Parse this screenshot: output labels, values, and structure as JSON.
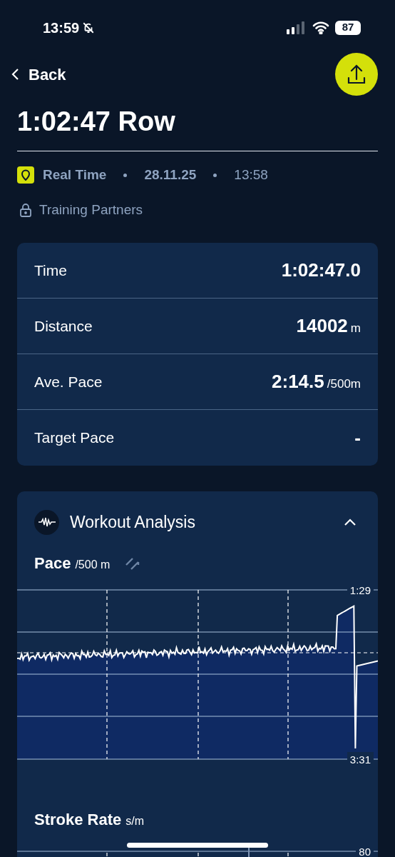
{
  "status_bar": {
    "time": "13:59",
    "battery": "87"
  },
  "nav": {
    "back": "Back"
  },
  "title": "1:02:47 Row",
  "meta": {
    "source": "Real Time",
    "date": "28.11.25",
    "time": "13:58"
  },
  "privacy": "Training Partners",
  "stats": [
    {
      "label": "Time",
      "value": "1:02:47.0"
    },
    {
      "label": "Distance",
      "value": "14002",
      "unit": "m"
    },
    {
      "label": "Ave. Pace",
      "value": "2:14.5",
      "unit": "/500m"
    },
    {
      "label": "Target Pace",
      "value": "-"
    }
  ],
  "analysis": {
    "title": "Workout Analysis",
    "expanded": true,
    "sections": [
      {
        "kind": "pace",
        "title": "Pace",
        "unit": "/500 m",
        "top_tick": "1:29",
        "bottom_tick": "3:31"
      },
      {
        "kind": "rate",
        "title": "Stroke Rate",
        "unit": "s/m",
        "top_tick": "80"
      }
    ]
  }
}
